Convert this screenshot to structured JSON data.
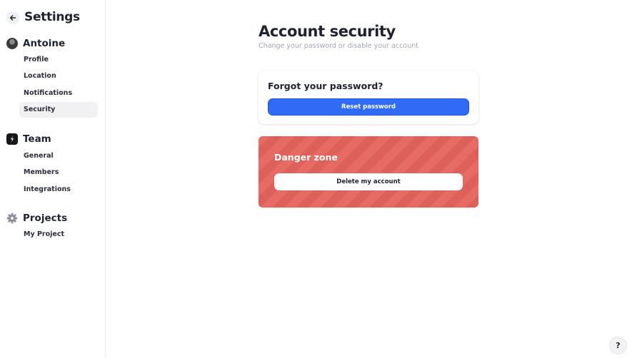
{
  "sidebar": {
    "title": "Settings",
    "sections": [
      {
        "label": "Antoine",
        "icon": "user-avatar",
        "items": [
          "Profile",
          "Location",
          "Notifications",
          "Security"
        ],
        "active_item": "Security"
      },
      {
        "label": "Team",
        "icon": "team-logo-icon",
        "items": [
          "General",
          "Members",
          "Integrations"
        ]
      },
      {
        "label": "Projects",
        "icon": "gear-icon",
        "items": [
          "My Project"
        ]
      }
    ]
  },
  "main": {
    "title": "Account security",
    "subtitle": "Change your password or disable your account",
    "password_card": {
      "title": "Forgot your password?",
      "button_label": "Reset password"
    },
    "danger_zone": {
      "title": "Danger zone",
      "button_label": "Delete my account"
    }
  },
  "help_button": {
    "label": "?"
  },
  "colors": {
    "accent": "#2f6bf5",
    "danger": "#e5635d",
    "text": "#1f2230",
    "muted": "#a3a6b3",
    "active_bg": "#f1f1f4"
  }
}
